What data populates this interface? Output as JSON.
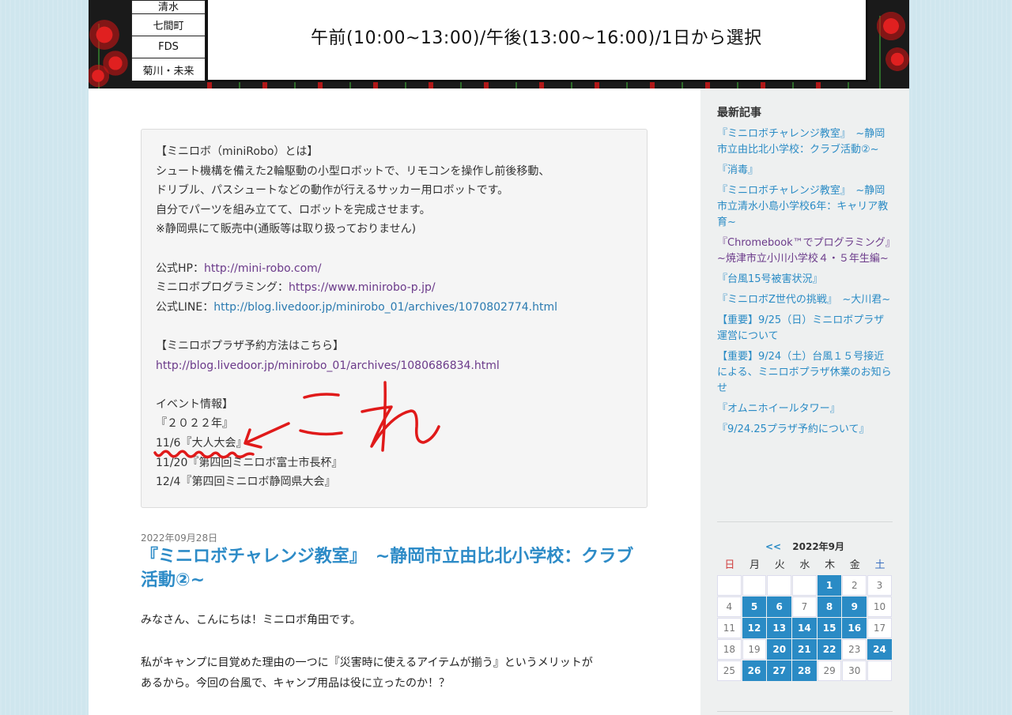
{
  "banner": {
    "locations": [
      "清水",
      "七間町",
      "FDS",
      "菊川・未来"
    ],
    "schedule_text": "午前(10:00~13:00)/午後(13:00~16:00)/1日から選択"
  },
  "info": {
    "lines": [
      "【ミニロボ（miniRobo）とは】",
      "シュート機構を備えた2輪駆動の小型ロボットで、リモコンを操作し前後移動、",
      "ドリブル、パスシュートなどの動作が行えるサッカー用ロボットです。",
      "自分でパーツを組み立てて、ロボットを完成させます。",
      "※静岡県にて販売中(通販等は取り扱っておりません)"
    ],
    "hp_label": "公式HP：",
    "hp_url": "http://mini-robo.com/",
    "prog_label": "ミニロボプログラミング：",
    "prog_url": "https://www.minirobo-p.jp/",
    "line_label": "公式LINE：",
    "line_url": "http://blog.livedoor.jp/minirobo_01/archives/1070802774.html",
    "plaza_label": "【ミニロボプラザ予約方法はこちら】",
    "plaza_url": "http://blog.livedoor.jp/minirobo_01/archives/1080686834.html",
    "event_header": "イベント情報】",
    "event_year": "『２０２２年』",
    "events": [
      "11/6『大人大会』",
      "11/20『第四回ミニロボ富士市長杯』",
      "12/4『第四回ミニロボ静岡県大会』"
    ]
  },
  "post": {
    "date": "2022年09月28日",
    "title": "『ミニロボチャレンジ教室』　~静岡市立由比北小学校：クラブ活動②~",
    "para1": "みなさん、こんにちは！ミニロボ角田です。",
    "para2_l1": "私がキャンプに目覚めた理由の一つに『災害時に使えるアイテムが揃う』というメリットが",
    "para2_l2": "あるから。今回の台風で、キャンプ用品は役に立ったのか！？"
  },
  "sidebar": {
    "recent_title": "最新記事",
    "recent": [
      "『ミニロボチャレンジ教室』　~静岡市立由比北小学校：クラブ活動②~",
      "『消毒』",
      "『ミニロボチャレンジ教室』　~静岡市立清水小島小学校6年：キャリア教育~",
      "『Chromebook™でプログラミング』~焼津市立小川小学校４・５年生編~",
      "『台風15号被害状況』",
      "『ミニロボZ世代の挑戦』　~大川君~",
      "【重要】9/25（日）ミニロボプラザ運営について",
      "【重要】9/24（土）台風１５号接近による、ミニロボプラザ休業のお知らせ",
      "『オムニホイールタワー』",
      "『9/24.25プラザ予約について』"
    ],
    "calendar": {
      "prev": "<<",
      "month": "2022年9月",
      "dow": [
        "日",
        "月",
        "火",
        "水",
        "木",
        "金",
        "土"
      ],
      "days": [
        "",
        "",
        "",
        "",
        "1",
        "2",
        "3",
        "4",
        "5",
        "6",
        "7",
        "8",
        "9",
        "10",
        "11",
        "12",
        "13",
        "14",
        "15",
        "16",
        "17",
        "18",
        "19",
        "20",
        "21",
        "22",
        "23",
        "24",
        "25",
        "26",
        "27",
        "28",
        "29",
        "30",
        ""
      ],
      "linked_days": [
        "1",
        "5",
        "6",
        "8",
        "9",
        "12",
        "13",
        "14",
        "15",
        "16",
        "20",
        "21",
        "22",
        "24",
        "26",
        "27",
        "28"
      ]
    }
  },
  "annotation": {
    "handwritten": "これ",
    "color": "#e01a1a"
  }
}
